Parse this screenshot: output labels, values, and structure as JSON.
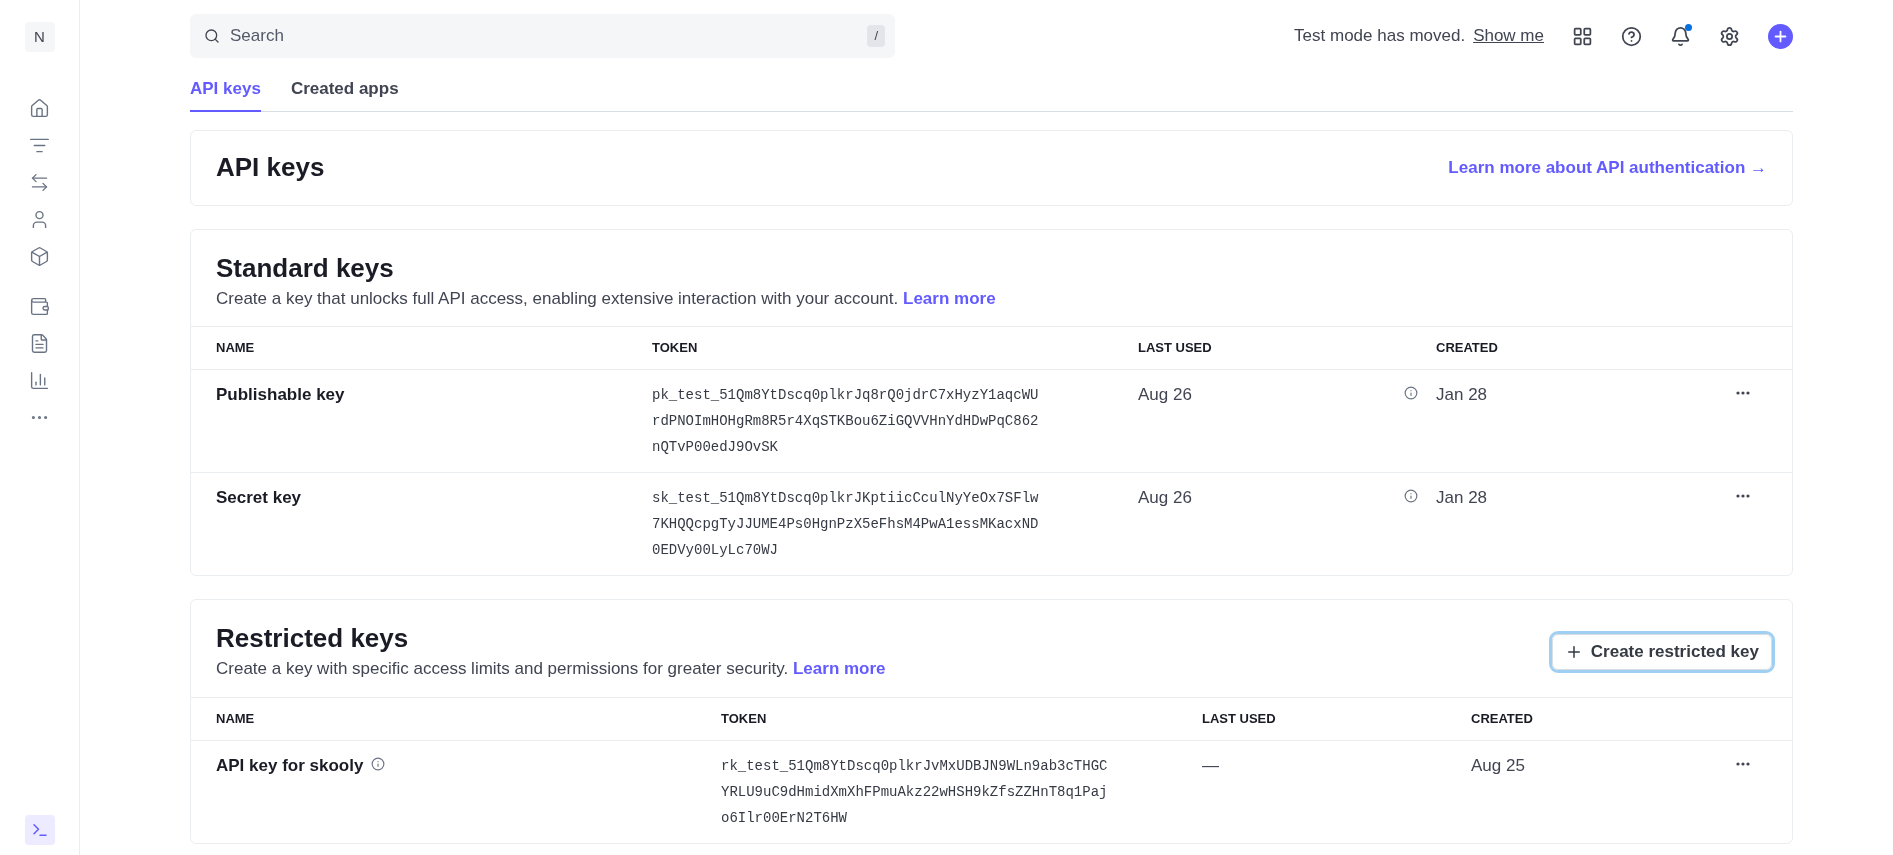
{
  "sidebar": {
    "account_initial": "N"
  },
  "search": {
    "placeholder": "Search",
    "shortcut": "/"
  },
  "notice": {
    "text": "Test mode has moved.",
    "link": "Show me"
  },
  "notifications": {
    "unread": true
  },
  "tabs": [
    {
      "label": "API keys",
      "selected": true
    },
    {
      "label": "Created apps",
      "selected": false
    }
  ],
  "header_card": {
    "title": "API keys",
    "link": "Learn more about API authentication →"
  },
  "standard_keys": {
    "title": "Standard keys",
    "description": "Create a key that unlocks full API access, enabling extensive interaction with your account.",
    "link": "Learn more",
    "columns": [
      "NAME",
      "TOKEN",
      "LAST USED",
      "CREATED"
    ],
    "rows": [
      {
        "name": "Publishable key",
        "name_info": false,
        "token": "pk_test_51Qm8YtDscq0plkrJq8rQ0jdrC7xHyzY1aqcWUrdPNOImHOHgRm8R5r4XqSTKBou6ZiGQVVHnYdHDwPqC862nQTvP00edJ9OvSK",
        "last_used": "Aug 26",
        "last_used_info": true,
        "created": "Jan 28"
      },
      {
        "name": "Secret key",
        "name_info": false,
        "token": "sk_test_51Qm8YtDscq0plkrJKptiicCculNyYeOx7SFlw7KHQQcpgTyJJUME4Ps0HgnPzX5eFhsM4PwA1essMKacxND0EDVy00LyLc70WJ",
        "last_used": "Aug 26",
        "last_used_info": true,
        "created": "Jan 28"
      }
    ]
  },
  "restricted_keys": {
    "title": "Restricted keys",
    "description": "Create a key with specific access limits and permissions for greater security.",
    "link": "Learn more",
    "button": "Create restricted key",
    "columns": [
      "NAME",
      "TOKEN",
      "LAST USED",
      "CREATED"
    ],
    "rows": [
      {
        "name": "API key for skooly",
        "name_info": true,
        "token": "rk_test_51Qm8YtDscq0plkrJvMxUDBJN9WLn9ab3cTHGCYRLU9uC9dHmidXmXhFPmuAkz22wHSH9kZfsZZHnT8q1Pajo6Ilr00ErN2T6HW",
        "last_used": "—",
        "last_used_info": false,
        "created": "Aug 25"
      }
    ]
  }
}
